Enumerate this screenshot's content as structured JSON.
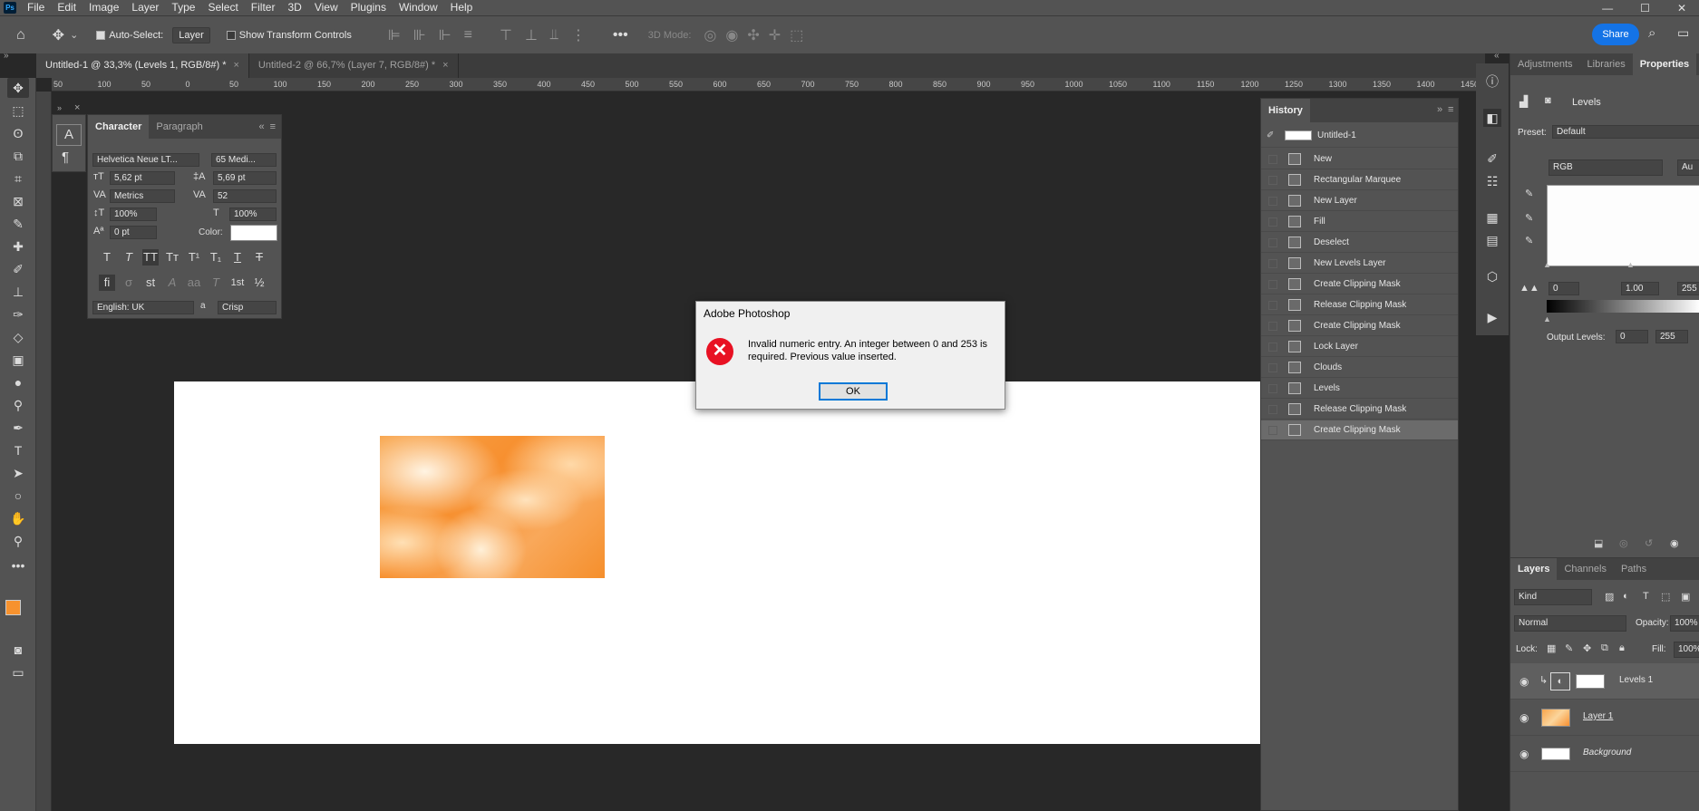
{
  "app": {
    "logo": "Ps"
  },
  "menu": [
    "File",
    "Edit",
    "Image",
    "Layer",
    "Type",
    "Select",
    "Filter",
    "3D",
    "View",
    "Plugins",
    "Window",
    "Help"
  ],
  "window_controls": [
    "—",
    "☐",
    "✕"
  ],
  "options": {
    "auto_select": "Auto-Select:",
    "auto_select_target": "Layer",
    "transform_controls": "Show Transform Controls",
    "mode_3d": "3D Mode:",
    "share": "Share"
  },
  "doc_tabs": [
    {
      "label": "Untitled-1 @ 33,3% (Levels 1, RGB/8#) *"
    },
    {
      "label": "Untitled-2 @ 66,7% (Layer 7, RGB/8#) *"
    }
  ],
  "ruler_ticks": [
    "50",
    "100",
    "50",
    "0",
    "50",
    "100",
    "150",
    "200",
    "250",
    "300",
    "350",
    "400",
    "450",
    "500",
    "550",
    "600",
    "650",
    "700",
    "750",
    "800",
    "850",
    "900",
    "950",
    "1000",
    "1050",
    "1100",
    "1150",
    "1200",
    "1250",
    "1300",
    "1350",
    "1400",
    "1450"
  ],
  "character": {
    "tabs": [
      "Character",
      "Paragraph"
    ],
    "font_family": "Helvetica Neue LT...",
    "font_style": "65 Medi...",
    "size": "5,62 pt",
    "leading": "5,69 pt",
    "kerning": "Metrics",
    "tracking": "52",
    "vscale": "100%",
    "hscale": "100%",
    "baseline": "0 pt",
    "color_label": "Color:",
    "glyphs_row1": [
      "T",
      "T",
      "TT",
      "Tт",
      "T¹",
      "T₁",
      "T",
      "T"
    ],
    "glyphs_row2": [
      "ﬁ",
      "σ",
      "st",
      "A",
      "aa",
      "T",
      "1st",
      "½"
    ],
    "language": "English: UK",
    "aa_label": "a",
    "antialias": "Crisp"
  },
  "dialog": {
    "title": "Adobe Photoshop",
    "message": "Invalid numeric entry. An integer between 0 and 253 is required.  Previous value inserted.",
    "ok": "OK"
  },
  "history": {
    "title": "History",
    "snapshot": "Untitled-1",
    "items": [
      "New",
      "Rectangular Marquee",
      "New Layer",
      "Fill",
      "Deselect",
      "New Levels Layer",
      "Create Clipping Mask",
      "Release Clipping Mask",
      "Create Clipping Mask",
      "Lock Layer",
      "Clouds",
      "Levels",
      "Release Clipping Mask",
      "Create Clipping Mask"
    ]
  },
  "properties": {
    "tabs": [
      "Adjustments",
      "Libraries",
      "Properties"
    ],
    "title": "Levels",
    "preset_label": "Preset:",
    "preset": "Default",
    "channel": "RGB",
    "auto": "Au",
    "input_black": "0",
    "input_gamma": "1.00",
    "input_white": "255",
    "output_label": "Output Levels:",
    "output_black": "0",
    "output_white": "255"
  },
  "layers": {
    "tabs": [
      "Layers",
      "Channels",
      "Paths"
    ],
    "kind": "Kind",
    "blend": "Normal",
    "opacity_label": "Opacity:",
    "opacity": "100%",
    "lock_label": "Lock:",
    "fill_label": "Fill:",
    "fill": "100%",
    "items": [
      {
        "name": "Levels 1"
      },
      {
        "name": "Layer 1"
      },
      {
        "name": "Background"
      }
    ]
  },
  "colors": {
    "foreground": "#f7922e",
    "background": "#ffffff",
    "accent": "#1473e6"
  }
}
